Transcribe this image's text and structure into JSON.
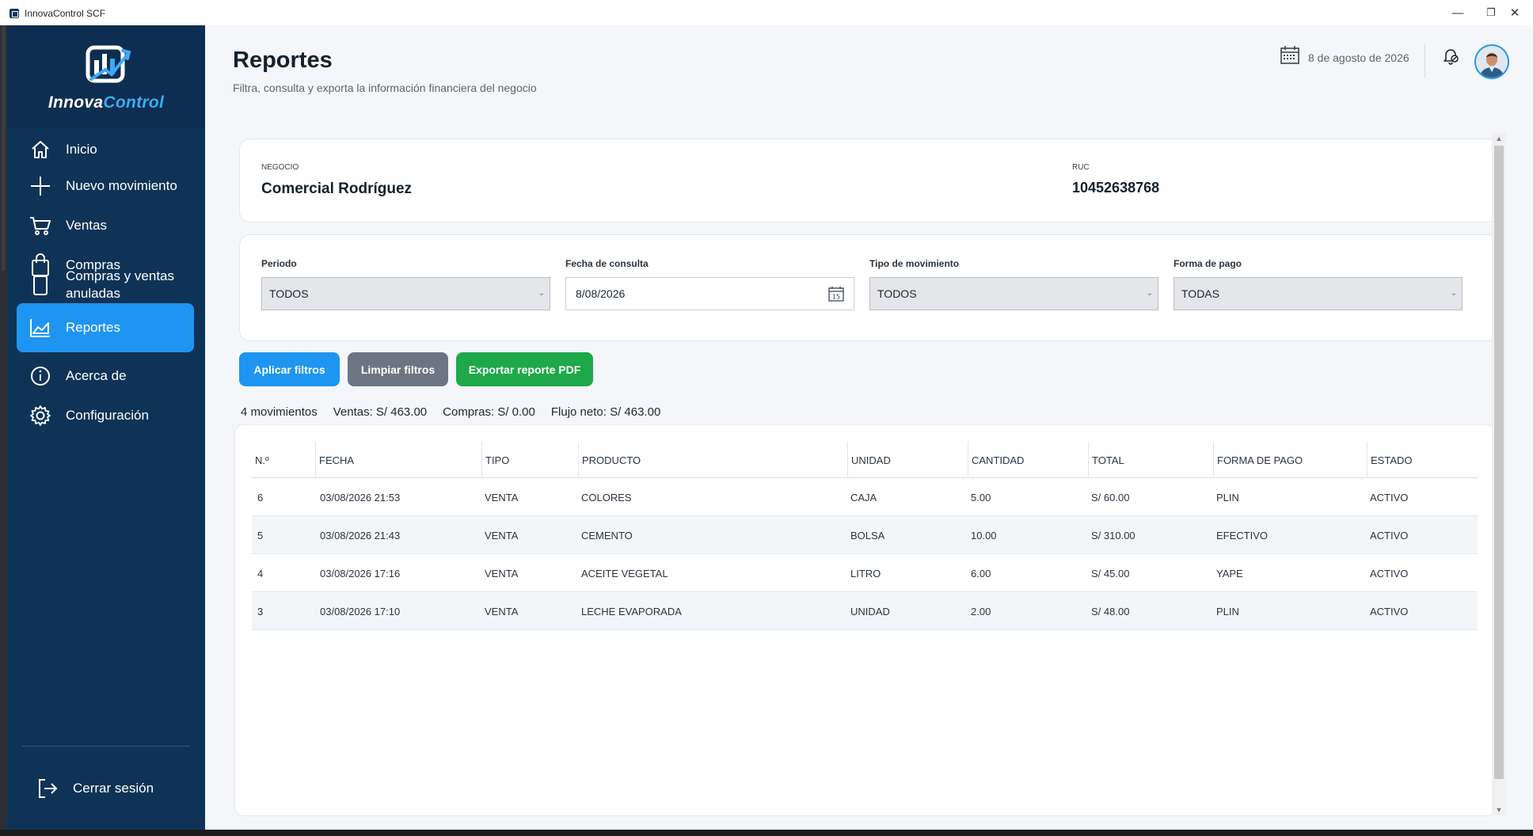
{
  "window": {
    "title": "InnovaControl SCF",
    "minimize_glyph": "—",
    "restore_glyph": "❐",
    "close_glyph": "✕"
  },
  "logo": {
    "text_main": "Innova",
    "text_accent": "Control"
  },
  "sidebar": {
    "items": [
      {
        "label": "Inicio",
        "icon": "home-icon"
      },
      {
        "label": "Nuevo movimiento",
        "icon": "plus-icon"
      },
      {
        "label": "Ventas",
        "icon": "cart-icon"
      },
      {
        "label": "Compras",
        "icon": "shopping-bag-icon"
      },
      {
        "label": "Compras y ventas anuladas",
        "icon": "document-icon"
      },
      {
        "label": "Reportes",
        "icon": "chart-icon",
        "active": true
      },
      {
        "label": "Acerca de",
        "icon": "info-icon"
      },
      {
        "label": "Configuración",
        "icon": "gear-icon"
      }
    ],
    "logout_label": "Cerrar sesión"
  },
  "header": {
    "title": "Reportes",
    "subtitle": "Filtra, consulta y exporta la información financiera del negocio",
    "date": "8 de agosto de 2026"
  },
  "business": {
    "name_caption": "NEGOCIO",
    "name": "Comercial Rodríguez",
    "ruc_caption": "RUC",
    "ruc": "10452638768"
  },
  "filters": {
    "period_label": "Periodo",
    "period_value": "TODOS",
    "date_label": "Fecha de consulta",
    "date_value": "8/08/2026",
    "type_label": "Tipo de movimiento",
    "type_value": "TODOS",
    "payment_label": "Forma de pago",
    "payment_value": "TODAS"
  },
  "buttons": {
    "apply": "Aplicar filtros",
    "clear": "Limpiar filtros",
    "export": "Exportar reporte PDF"
  },
  "colors": {
    "apply": "#1e95f0",
    "clear": "#6c7683",
    "export": "#1ea84a",
    "sidebar": "#0f3357",
    "active": "#1e95f0"
  },
  "summary": {
    "count": "4 movimientos",
    "sales": "Ventas: S/ 463.00",
    "purchases": "Compras: S/ 0.00",
    "net": "Flujo neto: S/ 463.00"
  },
  "table": {
    "columns": [
      "N.º",
      "FECHA",
      "TIPO",
      "PRODUCTO",
      "UNIDAD",
      "CANTIDAD",
      "TOTAL",
      "FORMA DE PAGO",
      "ESTADO"
    ],
    "rows": [
      [
        "6",
        "03/08/2026 21:53",
        "VENTA",
        "COLORES",
        "CAJA",
        "5.00",
        "S/ 60.00",
        "PLIN",
        "ACTIVO"
      ],
      [
        "5",
        "03/08/2026 21:43",
        "VENTA",
        "CEMENTO",
        "BOLSA",
        "10.00",
        "S/ 310.00",
        "EFECTIVO",
        "ACTIVO"
      ],
      [
        "4",
        "03/08/2026 17:16",
        "VENTA",
        "ACEITE VEGETAL",
        "LITRO",
        "6.00",
        "S/ 45.00",
        "YAPE",
        "ACTIVO"
      ],
      [
        "3",
        "03/08/2026 17:10",
        "VENTA",
        "LECHE EVAPORADA",
        "UNIDAD",
        "2.00",
        "S/ 48.00",
        "PLIN",
        "ACTIVO"
      ]
    ]
  }
}
